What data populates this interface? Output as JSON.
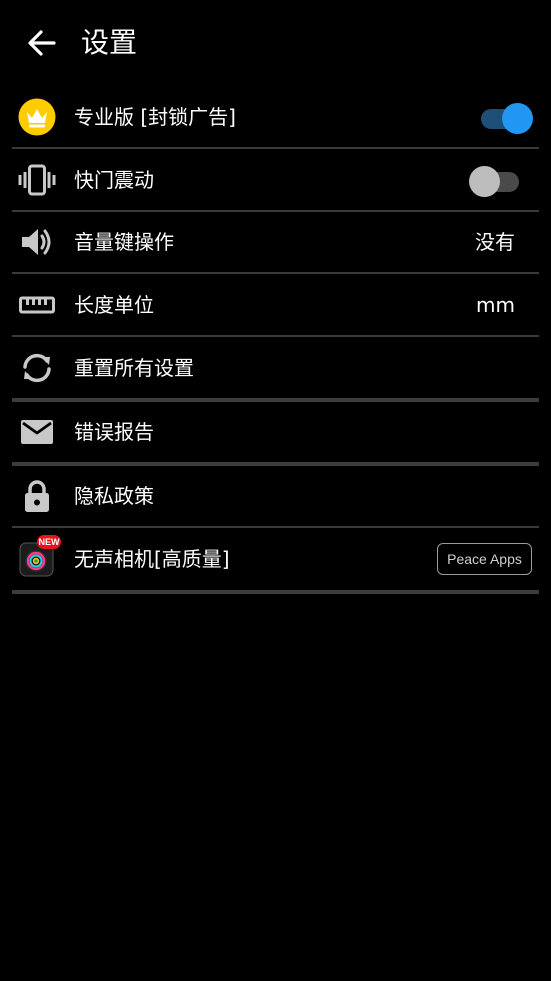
{
  "header": {
    "title": "设置"
  },
  "settings": {
    "pro": {
      "label": "专业版 [封锁广告]",
      "enabled": true
    },
    "shutter_vibration": {
      "label": "快门震动",
      "enabled": false
    },
    "volume_key": {
      "label": "音量键操作",
      "value": "没有"
    },
    "length_unit": {
      "label": "长度单位",
      "value": "mm"
    },
    "reset": {
      "label": "重置所有设置"
    },
    "bug_report": {
      "label": "错误报告"
    },
    "privacy": {
      "label": "隐私政策"
    },
    "silent_camera": {
      "label": "无声相机[高质量]",
      "badge": "NEW",
      "button": "Peace Apps"
    }
  },
  "colors": {
    "accent": "#2196f3",
    "crown_bg": "#ffcc00",
    "new_badge": "#e8141b",
    "icon_gray": "#c8c8c8"
  },
  "icons": {
    "back": "arrow-left-icon",
    "pro": "crown-icon",
    "vibration": "vibration-icon",
    "volume": "volume-icon",
    "unit": "ruler-icon",
    "reset": "sync-icon",
    "report": "mail-icon",
    "privacy": "lock-icon",
    "camera": "camera-app-icon"
  }
}
